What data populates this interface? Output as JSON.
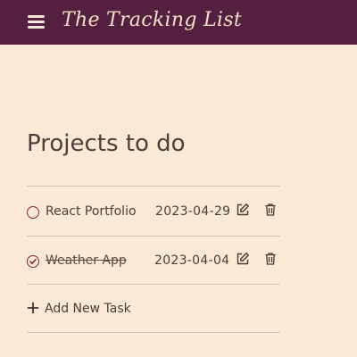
{
  "header": {
    "title": "The Tracking List"
  },
  "main": {
    "heading": "Projects to do",
    "tasks": [
      {
        "name": "React Portfolio",
        "date": "2023-04-29",
        "completed": false
      },
      {
        "name": "Weather App",
        "date": "2023-04-04",
        "completed": true
      }
    ],
    "add_label": "Add New Task"
  },
  "icons": {
    "menu": "hamburger-menu-icon",
    "edit": "edit-icon",
    "delete": "trash-icon",
    "add": "plus-icon",
    "status_open": "circle-icon",
    "status_done": "check-circle-icon"
  },
  "colors": {
    "header_bg": "#55203f",
    "page_bg": "#fbe9d5",
    "accent": "#8a2a2a"
  }
}
